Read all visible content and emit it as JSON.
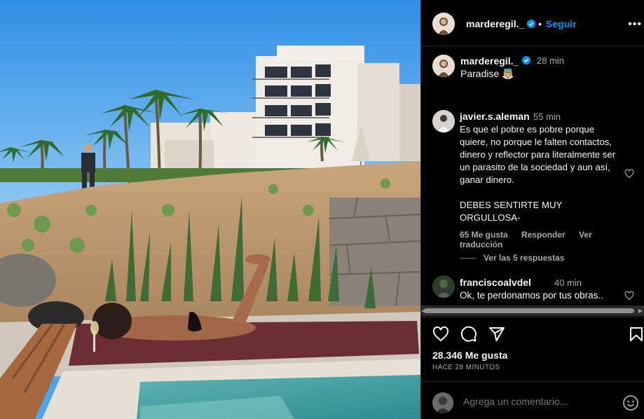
{
  "post": {
    "author": "marderegil._",
    "follow_label": "Seguir",
    "more_label": "•••",
    "caption": {
      "username": "marderegil._",
      "time": "28 min",
      "text": "Paradise 👼🏼"
    },
    "comments": [
      {
        "username": "javier.s.aleman",
        "time": "55 min",
        "text": "Es que el pobre es pobre porque quiere, no porque le falten contactos, dinero y reflector para literalmente ser un parasito de la sociedad y aun así, ganar dinero.\n\nDEBES SENTIRTE MUY ORGULLOSA-",
        "likes": "65 Me gusta",
        "reply_label": "Responder",
        "translate_label": "Ver traducción",
        "view_replies": "Ver las 5 respuestas"
      },
      {
        "username": "franciscoalvdel",
        "time": "40 min",
        "text": "Ok, te perdonamos por tus obras.."
      }
    ],
    "likes_count": "28.346 Me gusta",
    "time_ago": "HACE 28 MINUTOS",
    "comment_placeholder": "Agrega un comentario...",
    "icons": {
      "like": "heart-icon",
      "comment": "comment-icon",
      "share": "paper-plane-icon",
      "save": "bookmark-icon",
      "emoji": "emoji-icon",
      "verified": "verified-badge-icon"
    },
    "colors": {
      "background": "#000000",
      "accent": "#0095f6",
      "muted": "#a8a8a8",
      "verified": "#0095f6"
    }
  }
}
